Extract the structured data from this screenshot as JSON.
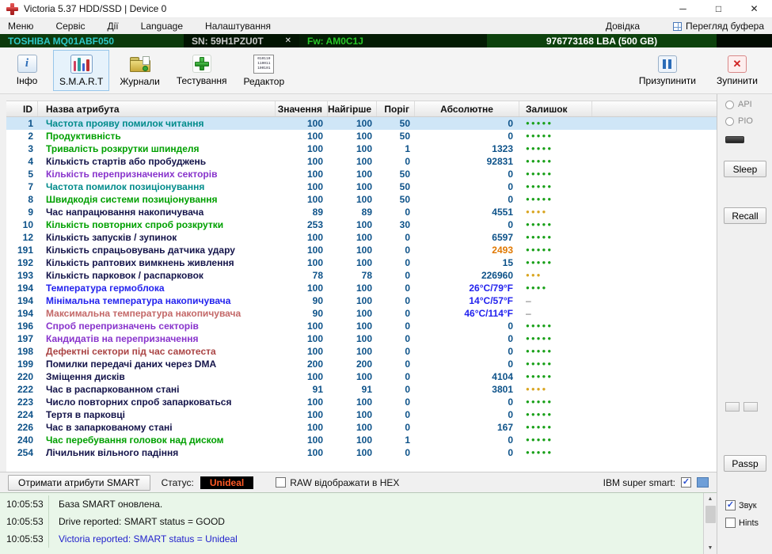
{
  "window": {
    "title": "Victoria 5.37 HDD/SSD | Device 0"
  },
  "icons": {
    "minimize": "─",
    "maximize": "□",
    "close": "✕",
    "info": "i",
    "check": "✓",
    "dot": "●",
    "dash": "–",
    "serial_close": "✕",
    "stop_x": "✕",
    "scroll_up": "▲",
    "scroll_down": "▼",
    "editor_lines": [
      "010110",
      "110011",
      "100101"
    ]
  },
  "menu": {
    "items": [
      "Меню",
      "Сервіс",
      "Дії",
      "Language",
      "Налаштування"
    ],
    "help": "Довідка",
    "buffer_view": "Перегляд буфера"
  },
  "device": {
    "model": "TOSHIBA MQ01ABF050",
    "serial": "SN: 59H1PZU0T",
    "firmware": "Fw: AM0C1J",
    "capacity": "976773168 LBA (500 GB)"
  },
  "toolbar": {
    "buttons": [
      {
        "label": "Інфо"
      },
      {
        "label": "S.M.A.R.T"
      },
      {
        "label": "Журнали"
      },
      {
        "label": "Тестування"
      },
      {
        "label": "Редактор"
      }
    ],
    "pause": "Призупинити",
    "stop": "Зупинити"
  },
  "table": {
    "headers": [
      "ID",
      "Назва атрибута",
      "Значення",
      "Найгірше",
      "Поріг",
      "Абсолютне",
      "Залишок"
    ],
    "rows": [
      {
        "id": "1",
        "name": "Частота прояву помилок читання",
        "name_color": "teal",
        "value": "100",
        "worst": "100",
        "threshold": "50",
        "raw": "0",
        "dots": 5,
        "dot_color": "good",
        "selected": true
      },
      {
        "id": "2",
        "name": "Продуктивність",
        "name_color": "green",
        "value": "100",
        "worst": "100",
        "threshold": "50",
        "raw": "0",
        "dots": 5,
        "dot_color": "good"
      },
      {
        "id": "3",
        "name": "Тривалість розкрутки шпинделя",
        "name_color": "green",
        "value": "100",
        "worst": "100",
        "threshold": "1",
        "raw": "1323",
        "dots": 5,
        "dot_color": "good"
      },
      {
        "id": "4",
        "name": "Кількість стартів або пробуджень",
        "name_color": "dark",
        "value": "100",
        "worst": "100",
        "threshold": "0",
        "raw": "92831",
        "dots": 5,
        "dot_color": "good"
      },
      {
        "id": "5",
        "name": "Кількість перепризначених секторів",
        "name_color": "purple",
        "value": "100",
        "worst": "100",
        "threshold": "50",
        "raw": "0",
        "dots": 5,
        "dot_color": "good"
      },
      {
        "id": "7",
        "name": "Частота помилок позиціонування",
        "name_color": "teal",
        "value": "100",
        "worst": "100",
        "threshold": "50",
        "raw": "0",
        "dots": 5,
        "dot_color": "good"
      },
      {
        "id": "8",
        "name": "Швидкодія системи позиціонування",
        "name_color": "green",
        "value": "100",
        "worst": "100",
        "threshold": "50",
        "raw": "0",
        "dots": 5,
        "dot_color": "good"
      },
      {
        "id": "9",
        "name": "Час напрацювання накопичувача",
        "name_color": "dark",
        "value": "89",
        "worst": "89",
        "threshold": "0",
        "raw": "4551",
        "dots": 4,
        "dot_color": "warn"
      },
      {
        "id": "10",
        "name": "Кількість повторних спроб розкрутки",
        "name_color": "green",
        "value": "253",
        "worst": "100",
        "threshold": "30",
        "raw": "0",
        "dots": 5,
        "dot_color": "good"
      },
      {
        "id": "12",
        "name": "Кількість запусків / зупинок",
        "name_color": "dark",
        "value": "100",
        "worst": "100",
        "threshold": "0",
        "raw": "6597",
        "dots": 5,
        "dot_color": "good"
      },
      {
        "id": "191",
        "name": "Кількість спрацьовувань датчика удару",
        "name_color": "dark",
        "value": "100",
        "worst": "100",
        "threshold": "0",
        "raw": "2493",
        "raw_color": "orange",
        "dots": 5,
        "dot_color": "good"
      },
      {
        "id": "192",
        "name": "Кількість раптових вимкнень живлення",
        "name_color": "dark",
        "value": "100",
        "worst": "100",
        "threshold": "0",
        "raw": "15",
        "dots": 5,
        "dot_color": "good"
      },
      {
        "id": "193",
        "name": "Кількість парковок / распарковок",
        "name_color": "dark",
        "value": "78",
        "worst": "78",
        "threshold": "0",
        "raw": "226960",
        "dots": 3,
        "dot_color": "warn"
      },
      {
        "id": "194",
        "name": "Температура гермоблока",
        "name_color": "blue",
        "value": "100",
        "worst": "100",
        "threshold": "0",
        "raw": "26°C/79°F",
        "raw_color": "blue",
        "dots": 4,
        "dot_color": "good"
      },
      {
        "id": "194",
        "name": "Мінімальна температура накопичувача",
        "name_color": "blue",
        "value": "90",
        "worst": "100",
        "threshold": "0",
        "raw": "14°C/57°F",
        "raw_color": "blue",
        "dash": true
      },
      {
        "id": "194",
        "name": "Максимальна температура накопичувача",
        "name_color": "rose",
        "value": "90",
        "worst": "100",
        "threshold": "0",
        "raw": "46°C/114°F",
        "raw_color": "blue",
        "dash": true
      },
      {
        "id": "196",
        "name": "Спроб перепризначень секторів",
        "name_color": "purple",
        "value": "100",
        "worst": "100",
        "threshold": "0",
        "raw": "0",
        "dots": 5,
        "dot_color": "good"
      },
      {
        "id": "197",
        "name": "Кандидатів на перепризначення",
        "name_color": "purple",
        "value": "100",
        "worst": "100",
        "threshold": "0",
        "raw": "0",
        "dots": 5,
        "dot_color": "good"
      },
      {
        "id": "198",
        "name": "Дефектні сектори під час самотеста",
        "name_color": "maroon",
        "value": "100",
        "worst": "100",
        "threshold": "0",
        "raw": "0",
        "dots": 5,
        "dot_color": "good"
      },
      {
        "id": "199",
        "name": "Помилки передачі даних через DMA",
        "name_color": "dark",
        "value": "200",
        "worst": "200",
        "threshold": "0",
        "raw": "0",
        "dots": 5,
        "dot_color": "good"
      },
      {
        "id": "220",
        "name": "Зміщення дисків",
        "name_color": "dark",
        "value": "100",
        "worst": "100",
        "threshold": "0",
        "raw": "4104",
        "dots": 5,
        "dot_color": "good"
      },
      {
        "id": "222",
        "name": "Час в распаркованном стані",
        "name_color": "dark",
        "value": "91",
        "worst": "91",
        "threshold": "0",
        "raw": "3801",
        "dots": 4,
        "dot_color": "warn"
      },
      {
        "id": "223",
        "name": "Число повторних спроб запарковаться",
        "name_color": "dark",
        "value": "100",
        "worst": "100",
        "threshold": "0",
        "raw": "0",
        "dots": 5,
        "dot_color": "good"
      },
      {
        "id": "224",
        "name": "Тертя в парковці",
        "name_color": "dark",
        "value": "100",
        "worst": "100",
        "threshold": "0",
        "raw": "0",
        "dots": 5,
        "dot_color": "good"
      },
      {
        "id": "226",
        "name": "Час в запаркованому стані",
        "name_color": "dark",
        "value": "100",
        "worst": "100",
        "threshold": "0",
        "raw": "167",
        "dots": 5,
        "dot_color": "good"
      },
      {
        "id": "240",
        "name": "Час перебування головок над диском",
        "name_color": "green",
        "value": "100",
        "worst": "100",
        "threshold": "1",
        "raw": "0",
        "dots": 5,
        "dot_color": "good"
      },
      {
        "id": "254",
        "name": "Лічильник вільного падіння",
        "name_color": "dark",
        "value": "100",
        "worst": "100",
        "threshold": "0",
        "raw": "0",
        "dots": 5,
        "dot_color": "good"
      }
    ]
  },
  "bottom": {
    "get_smart": "Отримати атрибути SMART",
    "status_label": "Статус:",
    "status_value": "Unideal",
    "raw_hex": "RAW відображати в HEX",
    "ibm": "IBM super smart:"
  },
  "log": {
    "lines": [
      {
        "time": "10:05:53",
        "text": "База SMART оновлена."
      },
      {
        "time": "10:05:53",
        "text": "Drive reported: SMART status = GOOD"
      },
      {
        "time": "10:05:53",
        "text": "Victoria reported: SMART status = Unideal"
      }
    ]
  },
  "sidebar": {
    "api": "API",
    "pio": "PIO",
    "sleep": "Sleep",
    "recall": "Recall",
    "passp": "Passp",
    "sound": "Звук",
    "hints": "Hints"
  },
  "colors": {
    "value_text": "#0d5289",
    "names": {
      "teal": "#008b8b",
      "green": "#00a000",
      "dark": "#14144a",
      "purple": "#8833cc",
      "blue": "#2222ee",
      "maroon": "#aa4444",
      "rose": "#c36868"
    },
    "raw": {
      "orange": "#e07800",
      "blue": "#2222ee"
    },
    "dots": {
      "good": "#18a018",
      "warn": "#d9a520"
    },
    "dash": "#666666",
    "selected_row_bg": "#cfe6f7",
    "status_badge_bg": "#000000",
    "status_badge_text": "#ff5a26",
    "log_link_text": "#2222cc",
    "model_text": "#2ec8c8",
    "firmware_text": "#28c828"
  }
}
